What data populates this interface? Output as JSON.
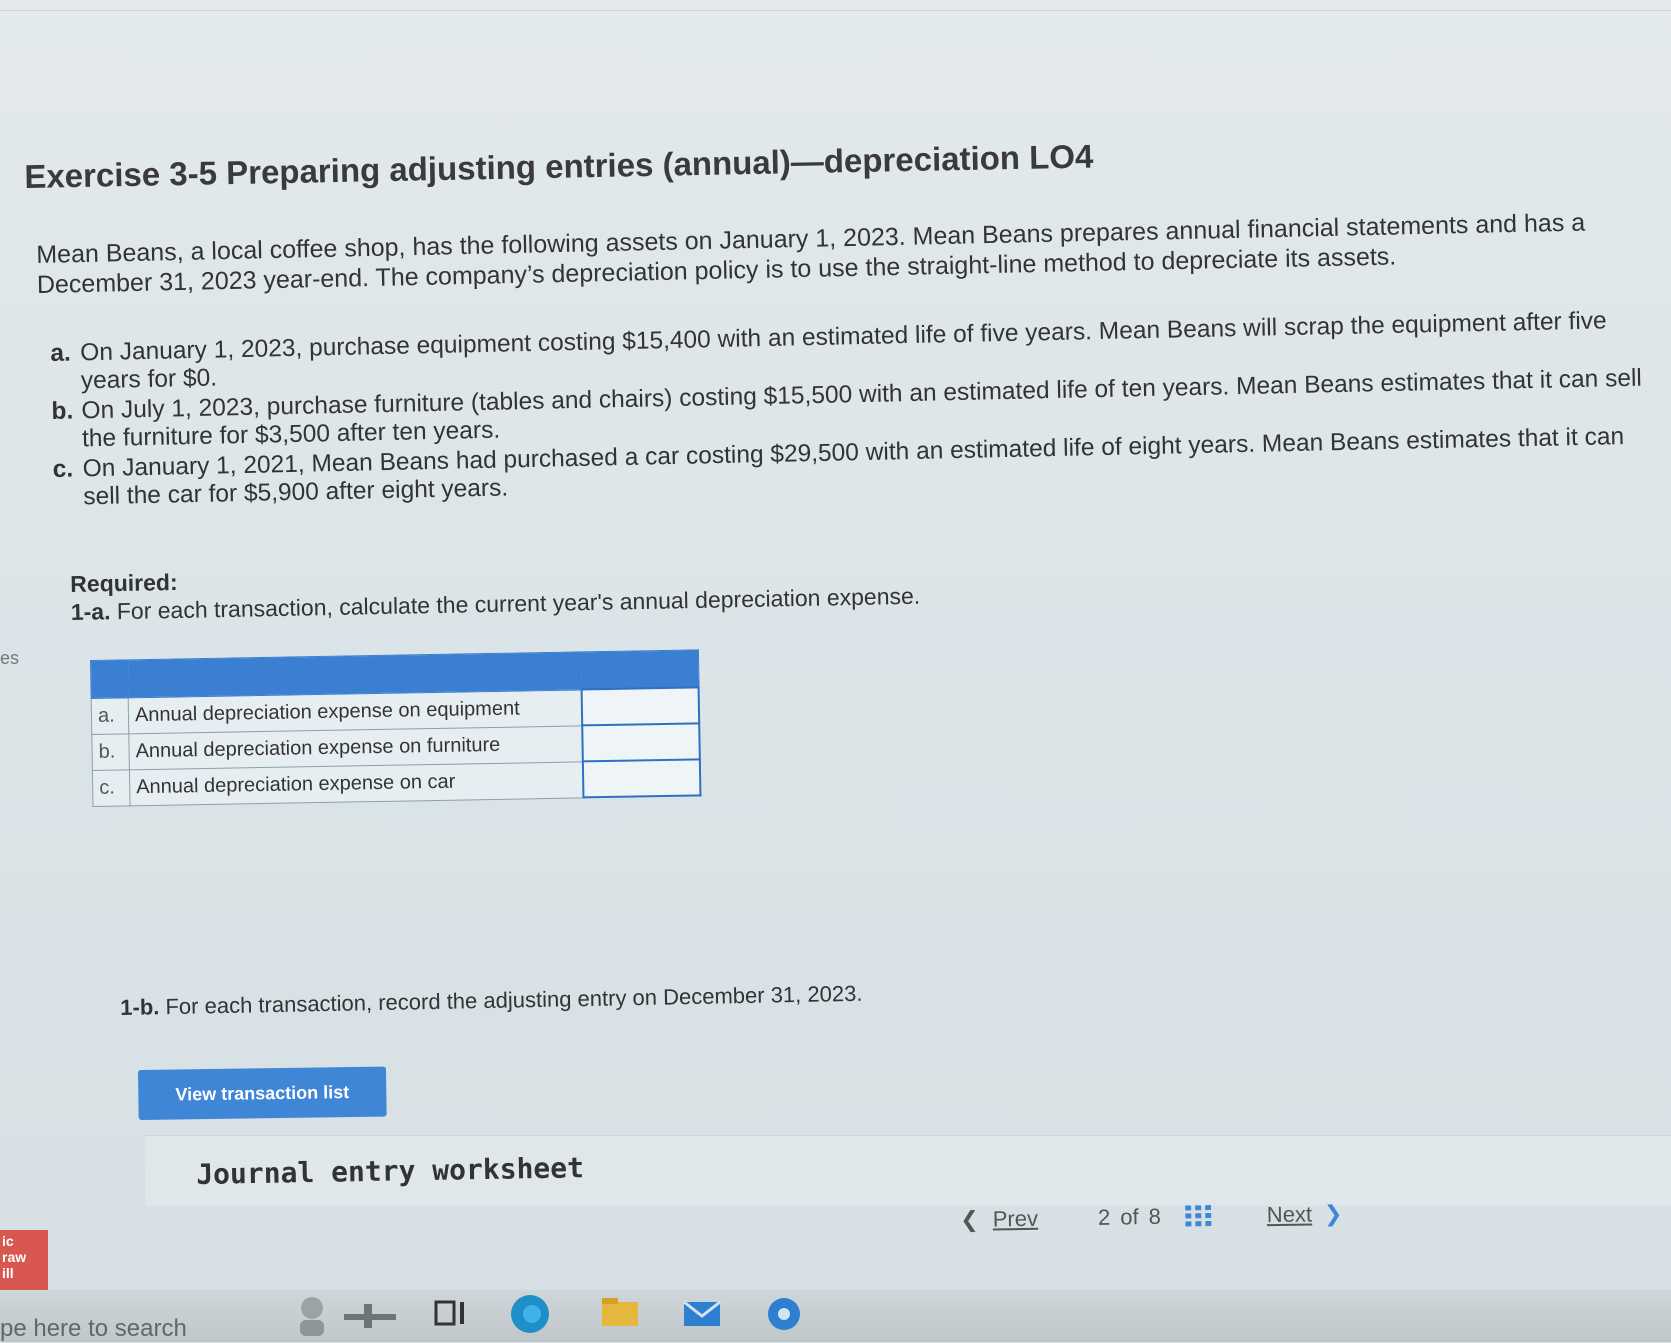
{
  "exercise": {
    "title": "Exercise 3-5 Preparing adjusting entries (annual)—depreciation LO4",
    "intro": "Mean Beans, a local coffee shop, has the following assets on January 1, 2023. Mean Beans prepares annual financial statements and has a December 31, 2023 year-end. The company’s depreciation policy is to use the straight-line method to depreciate its assets.",
    "items": [
      {
        "letter": "a.",
        "text": "On January 1, 2023, purchase equipment costing $15,400 with an estimated life of five years. Mean Beans will scrap the equipment after five years for $0."
      },
      {
        "letter": "b.",
        "text": "On July 1, 2023, purchase furniture (tables and chairs) costing $15,500 with an estimated life of ten years. Mean Beans estimates that it can sell the furniture for $3,500 after ten years."
      },
      {
        "letter": "c.",
        "text": "On January 1, 2021, Mean Beans had purchased a car costing $29,500 with an estimated life of eight years. Mean Beans estimates that it can sell the car for $5,900 after eight years."
      }
    ]
  },
  "required": {
    "heading": "Required:",
    "step_a_num": "1-a.",
    "step_a_text": "For each transaction, calculate the current year's annual depreciation expense.",
    "step_b_num": "1-b.",
    "step_b_text": "For each transaction, record the adjusting entry on December 31, 2023."
  },
  "dep_table": {
    "rows": [
      {
        "letter": "a.",
        "label": "Annual depreciation expense on equipment",
        "value": ""
      },
      {
        "letter": "b.",
        "label": "Annual depreciation expense on furniture",
        "value": ""
      },
      {
        "letter": "c.",
        "label": "Annual depreciation expense on car",
        "value": ""
      }
    ]
  },
  "buttons": {
    "view_transaction_list": "View transaction list"
  },
  "worksheet": {
    "title": "Journal entry worksheet"
  },
  "pager": {
    "prev": "Prev",
    "current": "2",
    "of": "of",
    "total": "8",
    "next": "Next"
  },
  "sidebar": {
    "partial_label": "es",
    "logo_text": "ic raw ill"
  },
  "taskbar": {
    "search_placeholder": "pe here to search"
  },
  "colors": {
    "accent_blue": "#3f86d6",
    "table_header": "#3a7fd1",
    "logo_red": "#d8574f"
  }
}
